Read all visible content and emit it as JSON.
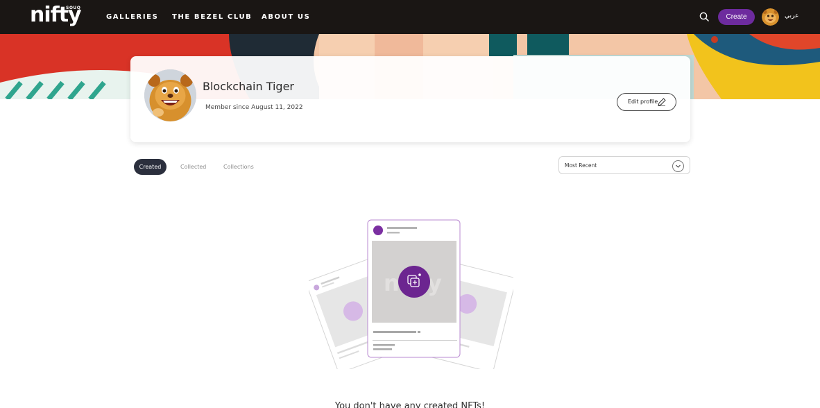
{
  "header": {
    "logo_text": "nifty",
    "logo_subtext": "SOUQ",
    "nav": [
      "GALLERIES",
      "THE BEZEL CLUB",
      "ABOUT US"
    ],
    "search_icon": "search-icon",
    "create_label": "Create",
    "language_label": "عربي"
  },
  "banner": {
    "colors": [
      "#e23b2e",
      "#f6c9a8",
      "#0e5a5c",
      "#f0c419"
    ]
  },
  "profile": {
    "name": "Blockchain Tiger",
    "member_since": "Member since August 11, 2022",
    "edit_label": "Edit profile",
    "edit_icon": "pencil-icon"
  },
  "tabs": [
    {
      "label": "Created",
      "active": true
    },
    {
      "label": "Collected",
      "active": false
    },
    {
      "label": "Collections",
      "active": false
    }
  ],
  "sort": {
    "selected": "Most Recent",
    "icon": "chevron-down-icon"
  },
  "empty_state": {
    "illustration_icon": "add-nft-icon",
    "message": "You don't have any created NFTs!"
  },
  "colors": {
    "accent": "#6d2b9e",
    "nav_background": "#1a1614",
    "active_tab": "#2b2f3d"
  }
}
